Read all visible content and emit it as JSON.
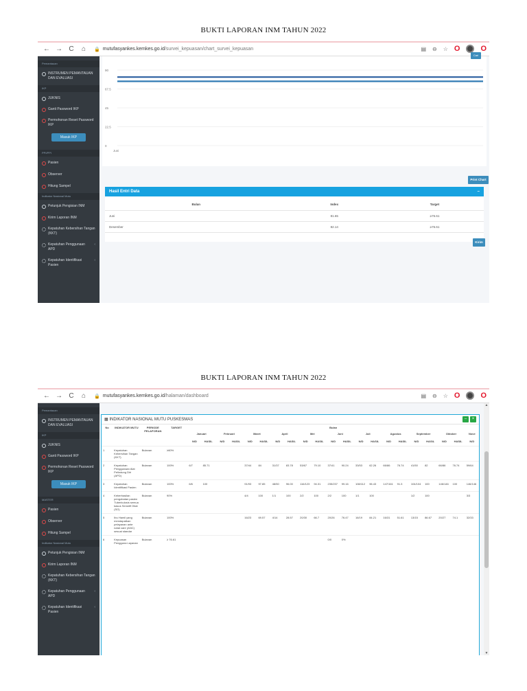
{
  "page_titles": [
    "BUKTI LAPORAN INM TAHUN 2022",
    "BUKTI LAPORAN INM TAHUN 2022"
  ],
  "browser": {
    "url1_domain": "mutufasyankes.kemkes.go.id",
    "url1_path": "/survei_kepuasan/chart_survei_kepuasan",
    "url2_domain": "mutufasyankes.kemkes.go.id",
    "url2_path": "/halaman/dashboard"
  },
  "sidebar": {
    "heading_pemantauan": "Pemantauan",
    "instrumen": "INSTRUMEN PEMANTAUAN DAN EVALUASI",
    "heading_ikp": "IKP",
    "jukns": "JUKNIS",
    "ganti_password": "Ganti Password IKP",
    "reset_password": "Permohonan Reset Password IKP",
    "masuk_ikp": "Masuk IKP",
    "heading_ppi": "PPI/PPI",
    "heading_ppi2": "MASTER",
    "pasien": "Pasien",
    "observer": "Observer",
    "hitung_sampel": "Hitung Sampel",
    "heading_inm": "Indikator Nasional Mutu",
    "petunjuk": "Petunjuk Pengisian INM",
    "kirim_laporan": "Kirim Laporan INM",
    "kebersihan_tangan": "Kepatuhan Kebersihan Tangan (KKT)",
    "penggunaan_apd": "Kepatuhan Penggunaan APD",
    "identifikasi_pasien": "Kepatuhan Identifikasi Pasien"
  },
  "shot1": {
    "cari_label": "Cari",
    "print_label": "Print Chart",
    "result_title": "Hasil Entri Data",
    "collapse": "–",
    "table_headers": [
      "Bulan",
      "Index",
      "Target"
    ],
    "rows": [
      [
        "Juni",
        "81.65",
        "≥76.61"
      ],
      [
        "Desember",
        "82.14",
        "≥76.61"
      ]
    ],
    "kirim_label": "Kirim"
  },
  "chart_data": {
    "type": "line",
    "x": [
      "Juni"
    ],
    "ylim": [
      0,
      90
    ],
    "y_ticks": [
      "0",
      "22.5",
      "45",
      "67.5",
      "90"
    ],
    "series": [
      {
        "values": [
          81.65
        ],
        "color": "#2a5d9f"
      },
      {
        "values": [
          76.61
        ],
        "color": "#2f7ab3"
      }
    ]
  },
  "shot2": {
    "card_title": "INDIKATOR NASIONAL MUTU PUSKESMAS",
    "minimize": "–",
    "close": "×",
    "col_no": "No",
    "col_indikator": "INDIKATOR MUTU",
    "col_periode": "PERIODE PELAPORAN",
    "col_target": "TARGET",
    "col_bulan": "Bulan",
    "months": [
      "Januari",
      "Februari",
      "Maret",
      "April",
      "Mei",
      "Juni",
      "Juli",
      "Agustus",
      "September",
      "Oktober",
      "Nove"
    ],
    "sub_nd": "N/D",
    "sub_hasil": "HASIL",
    "rows": [
      {
        "no": "1",
        "name": "Kepatuhan Kebersihan Tangan (KKT)",
        "periode": "Bulanan",
        "target": "≥60%",
        "vals": [
          "",
          "",
          "",
          "",
          "",
          "",
          "",
          "",
          "",
          "",
          "",
          "",
          "",
          "",
          "",
          "",
          "",
          "",
          "",
          "",
          ""
        ]
      },
      {
        "no": "2",
        "name": "Kepatuhan Penggunaan Alat Pelindung Diri (APD)",
        "periode": "Bulanan",
        "target": "100%",
        "vals": [
          "6/7",
          "85.71",
          "",
          "",
          "37/44",
          "84",
          "31/37",
          "83.78",
          "53/67",
          "79.10",
          "37/41",
          "90.24",
          "33/53",
          "62.26",
          "66/86",
          "76.74",
          "41/50",
          "82",
          "66/86",
          "76.74",
          "59/64"
        ]
      },
      {
        "no": "3",
        "name": "Kepatuhan Identifikasi Pasien",
        "periode": "Bulanan",
        "target": "100%",
        "vals": [
          "6/6",
          "100",
          "",
          "",
          "91/93",
          "97.85",
          "48/50",
          "96.00",
          "116/123",
          "94.31",
          "235/237",
          "99.16",
          "108/112",
          "96.43",
          "147/161",
          "91.3",
          "104/104",
          "100",
          "146/146",
          "100",
          "146/146"
        ]
      },
      {
        "no": "4",
        "name": "Keberhasilan pengobatan pasien Tuberkulosis semua kasus Sensitif Obat (SO)",
        "periode": "Bulanan",
        "target": "90%",
        "vals": [
          "",
          "",
          "",
          "",
          "4/4",
          "100",
          "1/1",
          "100",
          "2/2",
          "100",
          "2/2",
          "100",
          "1/1",
          "100",
          "",
          "",
          "1/2",
          "100",
          "",
          "",
          "3/3"
        ]
      },
      {
        "no": "5",
        "name": "Ibu Hamil yang mendapatkan pelayanan ante natal care (ANC) sesuai standar",
        "periode": "Bulanan",
        "target": "100%",
        "vals": [
          "",
          "",
          "",
          "",
          "16/23",
          "69.57",
          "4/14",
          "28.57",
          "20/30",
          "66.7",
          "20/26",
          "76.47",
          "16/19",
          "84.21",
          "16/31",
          "51.61",
          "13/15",
          "86.67",
          "20/27",
          "74.1",
          "32/33"
        ]
      },
      {
        "no": "6",
        "name": "Kepuasan Pengguna Layanan",
        "periode": "Bulanan",
        "target": "≥ 76.61",
        "vals": [
          "",
          "",
          "",
          "",
          "",
          "",
          "",
          "",
          "",
          "",
          "0/0",
          "0%",
          "",
          "",
          "",
          "",
          "",
          "",
          "",
          "",
          ""
        ]
      }
    ]
  }
}
